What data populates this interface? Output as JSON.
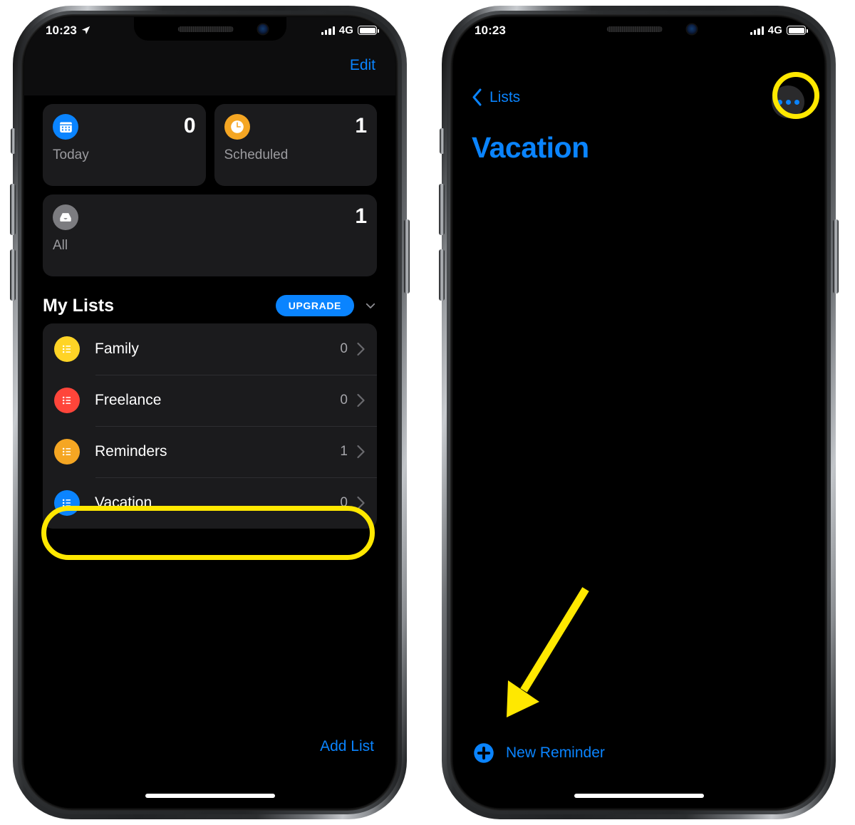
{
  "left_phone": {
    "status_bar": {
      "time": "10:23",
      "location_icon": "location-arrow-icon",
      "signal_icon": "cellular-bars-icon",
      "network": "4G",
      "battery_icon": "battery-full-icon"
    },
    "nav": {
      "edit_label": "Edit"
    },
    "smart_lists": [
      {
        "label": "Today",
        "count": "0",
        "icon": "calendar-icon",
        "color": "#0a84ff"
      },
      {
        "label": "Scheduled",
        "count": "1",
        "icon": "clock-icon",
        "color": "#f5a623"
      },
      {
        "label": "All",
        "count": "1",
        "icon": "inbox-tray-icon",
        "color": "#7c7c80"
      }
    ],
    "section": {
      "title": "My Lists",
      "upgrade_label": "UPGRADE",
      "collapse_icon": "chevron-down-icon"
    },
    "lists": [
      {
        "name": "Family",
        "count": "0",
        "icon": "list-bullet-icon",
        "color": "#ffd426",
        "chevron": "chevron-right-icon",
        "highlighted": false
      },
      {
        "name": "Freelance",
        "count": "0",
        "icon": "list-bullet-icon",
        "color": "#ff453a",
        "chevron": "chevron-right-icon",
        "highlighted": false
      },
      {
        "name": "Reminders",
        "count": "1",
        "icon": "list-bullet-icon",
        "color": "#f5a623",
        "chevron": "chevron-right-icon",
        "highlighted": false
      },
      {
        "name": "Vacation",
        "count": "0",
        "icon": "list-bullet-icon",
        "color": "#0a84ff",
        "chevron": "chevron-right-icon",
        "highlighted": true
      }
    ],
    "add_list_label": "Add List"
  },
  "right_phone": {
    "status_bar": {
      "time": "10:23",
      "signal_icon": "cellular-bars-icon",
      "network": "4G",
      "battery_icon": "battery-full-icon"
    },
    "nav": {
      "back_icon": "chevron-left-icon",
      "back_label": "Lists",
      "more_icon": "ellipsis-icon"
    },
    "title": "Vacation",
    "new_reminder": {
      "icon": "plus-circle-icon",
      "label": "New Reminder"
    }
  },
  "annotations": {
    "highlight_color": "#ffe800",
    "vacation_row_oval": "highlight-oval-vacation-row",
    "more_button_circle": "highlight-circle-more-button",
    "arrow_to_new_reminder": "annotation-arrow"
  },
  "colors": {
    "accent_blue": "#0a84ff",
    "card_background": "#1b1b1d",
    "screen_background": "#000000",
    "highlight_yellow": "#ffe800"
  }
}
